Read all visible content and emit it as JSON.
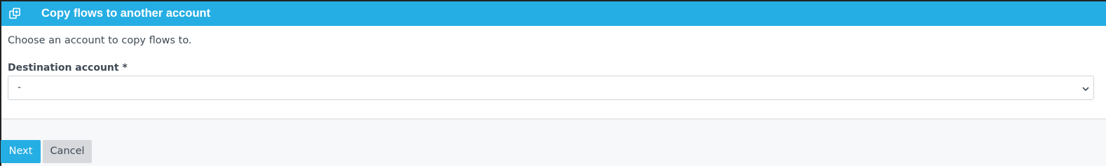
{
  "header": {
    "icon": "copy-icon",
    "title": "Copy flows to another account"
  },
  "body": {
    "intro_text": "Choose an account to copy flows to.",
    "destination": {
      "label": "Destination account *",
      "selected_value": "-",
      "icon": "chevron-down-icon"
    }
  },
  "footer": {
    "next_label": "Next",
    "cancel_label": "Cancel"
  },
  "colors": {
    "accent": "#25aee4",
    "cancel_bg": "#d7d9dd",
    "footer_bg": "#f7f8f9"
  }
}
